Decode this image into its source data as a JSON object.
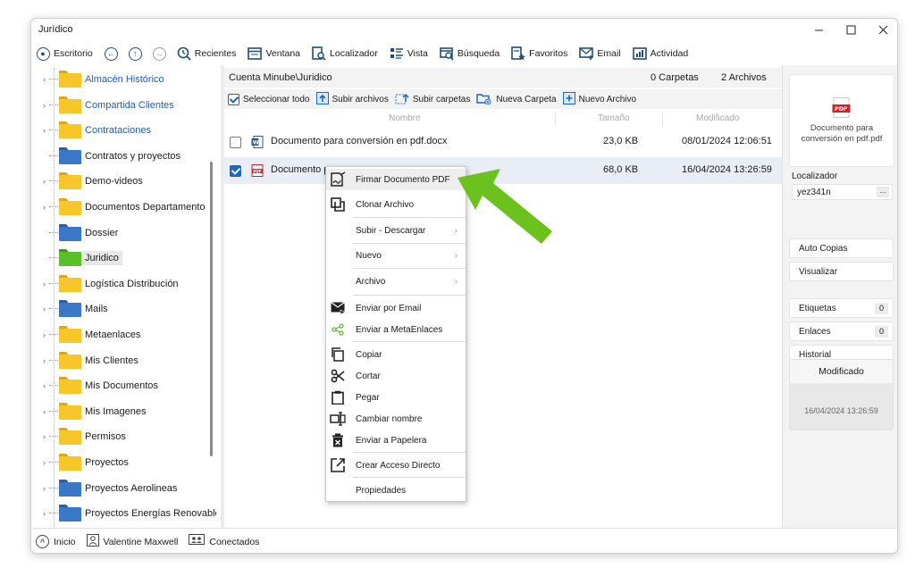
{
  "window": {
    "title": "Jurídico"
  },
  "toolbar": {
    "escritorio": "Escritorio",
    "recientes": "Recientes",
    "ventana": "Ventana",
    "localizador": "Localizador",
    "vista": "Vista",
    "busqueda": "Búsqueda",
    "favoritos": "Favoritos",
    "email": "Email",
    "actividad": "Actividad"
  },
  "tree": {
    "items": [
      {
        "label": "Almacén Histórico",
        "color": "yellow",
        "link": true,
        "expandable": true
      },
      {
        "label": "Compartida Clientes",
        "color": "yellow",
        "link": true,
        "expandable": true
      },
      {
        "label": "Contrataciones",
        "color": "yellow",
        "link": true,
        "expandable": true
      },
      {
        "label": "Contratos y proyectos",
        "color": "blue",
        "link": false,
        "expandable": false
      },
      {
        "label": "Demo-videos",
        "color": "yellow",
        "link": false,
        "expandable": true
      },
      {
        "label": "Documentos Departamento",
        "color": "yellow",
        "link": false,
        "expandable": true
      },
      {
        "label": "Dossier",
        "color": "blue",
        "link": false,
        "expandable": false
      },
      {
        "label": "Juridico",
        "color": "green",
        "link": false,
        "expandable": false,
        "selected": true
      },
      {
        "label": "Logística Distribución",
        "color": "yellow",
        "link": false,
        "expandable": true
      },
      {
        "label": "Mails",
        "color": "blue",
        "link": false,
        "expandable": true
      },
      {
        "label": "Metaenlaces",
        "color": "yellow",
        "link": false,
        "expandable": true
      },
      {
        "label": "Mis Clientes",
        "color": "yellow",
        "link": false,
        "expandable": true
      },
      {
        "label": "Mis Documentos",
        "color": "yellow",
        "link": false,
        "expandable": true
      },
      {
        "label": "Mis Imagenes",
        "color": "yellow",
        "link": false,
        "expandable": true
      },
      {
        "label": "Permisos",
        "color": "yellow",
        "link": false,
        "expandable": true
      },
      {
        "label": "Proyectos",
        "color": "yellow",
        "link": false,
        "expandable": true
      },
      {
        "label": "Proyectos Aerolineas",
        "color": "blue",
        "link": false,
        "expandable": true
      },
      {
        "label": "Proyectos Energías Renovables",
        "color": "blue",
        "link": false,
        "expandable": true
      }
    ]
  },
  "main": {
    "path": "Cuenta Minube\\Juridico",
    "folders_count": "0 Carpetas",
    "files_count": "2 Archivos",
    "actions": {
      "select_all": "Seleccionar todo",
      "upload_files": "Subir archivos",
      "upload_folders": "Subir carpetas",
      "new_folder": "Nueva Carpeta",
      "new_file": "Nuevo Archivo"
    },
    "columns": {
      "name": "Nombre",
      "size": "Tamaño",
      "modified": "Modificado"
    },
    "files": [
      {
        "name": "Documento para conversión en pdf.docx",
        "size": "23,0 KB",
        "modified": "08/01/2024 12:06:51",
        "type": "docx",
        "checked": false
      },
      {
        "name": "Documento p",
        "size": "68,0 KB",
        "modified": "16/04/2024 13:26:59",
        "type": "pdf",
        "checked": true
      }
    ]
  },
  "context_menu": {
    "items": [
      {
        "label": "Firmar Documento PDF",
        "icon": "sign-pdf-icon"
      },
      {
        "label": "Clonar Archivo",
        "icon": "clone-icon"
      },
      {
        "label": "Subir - Descargar",
        "submenu": true
      },
      {
        "label": "Nuevo",
        "submenu": true
      },
      {
        "label": "Archivo",
        "submenu": true
      },
      {
        "label": "Enviar por Email",
        "icon": "email-send-icon"
      },
      {
        "label": "Enviar a MetaEnlaces",
        "icon": "share-icon"
      },
      {
        "label": "Copiar",
        "icon": "copy-icon"
      },
      {
        "label": "Cortar",
        "icon": "scissors-icon"
      },
      {
        "label": "Pegar",
        "icon": "paste-icon"
      },
      {
        "label": "Cambiar nombre",
        "icon": "rename-icon"
      },
      {
        "label": "Enviar a Papelera",
        "icon": "trash-icon"
      },
      {
        "label": "Crear Acceso Directo",
        "icon": "shortcut-icon"
      },
      {
        "label": "Propiedades"
      }
    ]
  },
  "right_panel": {
    "preview_badge": "PDF",
    "preview_caption_1": "Documento para",
    "preview_caption_2": "conversión en pdf.pdf",
    "localizador_label": "Localizador",
    "localizador_value": "yez341n",
    "more": "...",
    "auto_copias": "Auto Copias",
    "visualizar": "Visualizar",
    "etiquetas": "Etiquetas",
    "etiquetas_count": "0",
    "enlaces": "Enlaces",
    "enlaces_count": "0",
    "historial": "Historial",
    "modificado_label": "Modificado",
    "modificado_value": "16/04/2024 13:26:59"
  },
  "statusbar": {
    "inicio": "Inicio",
    "user": "Valentine Maxwell",
    "status": "Conectados"
  },
  "colors": {
    "accent": "#1669c6",
    "folder_yellow": "#f7c729",
    "folder_blue": "#3a78c6",
    "folder_green": "#5bbf2a",
    "arrow_green": "#6cc21c",
    "pdf_red": "#d32027",
    "link_blue": "#1f5fae"
  }
}
